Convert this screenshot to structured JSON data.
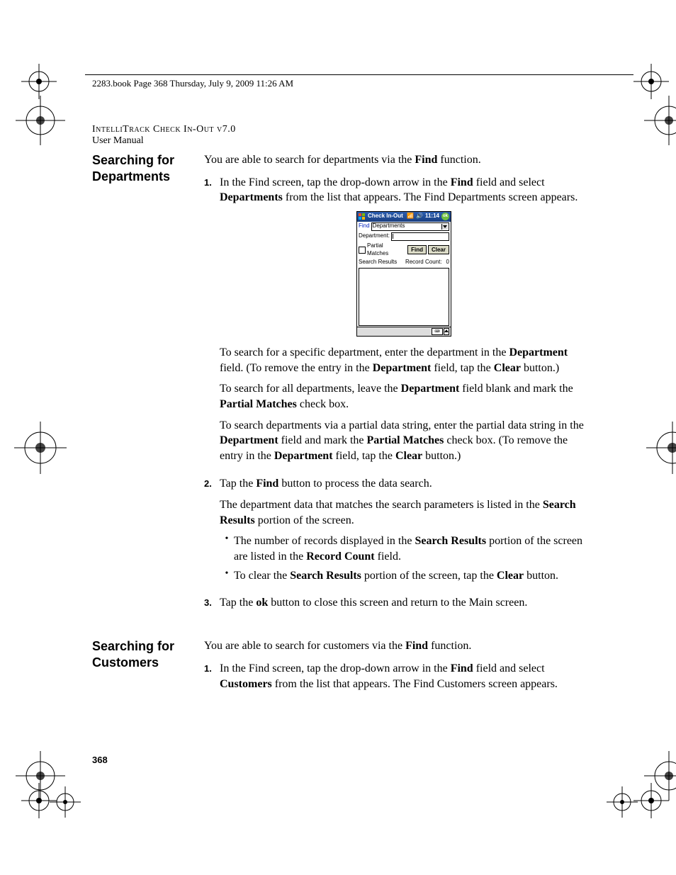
{
  "pageHeader": "2283.book  Page 368  Thursday, July 9, 2009  11:26 AM",
  "runningHead1": "IntelliTrack Check In-Out v7.0",
  "runningHead2": "User Manual",
  "pageNumber": "368",
  "sections": [
    {
      "heading": "Searching for Departments",
      "intro_pre": "You are able to search for departments via the ",
      "intro_bold": "Find",
      "intro_post": " function.",
      "steps": [
        {
          "num": "1.",
          "parts": [
            "In the Find screen, tap the drop-down arrow in the ",
            "Find",
            " field and select ",
            "Departments",
            " from the list that appears. The Find Departments screen appears."
          ],
          "bolds": [
            1,
            3
          ]
        }
      ],
      "afterImage": [
        {
          "parts": [
            "To search for a specific department, enter the department in the ",
            "Department",
            " field. (To remove the entry in the ",
            "Department",
            " field, tap the ",
            "Clear",
            " button.)"
          ],
          "bolds": [
            1,
            3,
            5
          ]
        },
        {
          "parts": [
            "To search for all departments, leave the ",
            "Department",
            " field blank and mark the ",
            "Partial Matches",
            " check box."
          ],
          "bolds": [
            1,
            3
          ]
        },
        {
          "parts": [
            "To search departments via a partial data string, enter the partial data string in the ",
            "Department",
            " field and mark the ",
            "Partial Matches",
            " check box. (To remove the entry in the ",
            "Department",
            " field, tap the ",
            "Clear",
            " button.)"
          ],
          "bolds": [
            1,
            3,
            5,
            7
          ]
        }
      ],
      "steps2": [
        {
          "num": "2.",
          "parts": [
            "Tap the ",
            "Find",
            " button to process the data search."
          ],
          "bolds": [
            1
          ],
          "followParas": [
            {
              "parts": [
                "The department data that matches the search parameters is listed in the ",
                "Search Results",
                " portion of the screen."
              ],
              "bolds": [
                1
              ]
            }
          ],
          "bullets": [
            {
              "parts": [
                "The number of records displayed in the ",
                "Search Results",
                " portion of the screen are listed in the ",
                "Record Count",
                " field."
              ],
              "bolds": [
                1,
                3
              ]
            },
            {
              "parts": [
                "To clear the ",
                "Search Results",
                " portion of the screen, tap the ",
                "Clear",
                " button."
              ],
              "bolds": [
                1,
                3
              ]
            }
          ]
        },
        {
          "num": "3.",
          "parts": [
            "Tap the ",
            "ok",
            " button to close this screen and return to the Main screen."
          ],
          "bolds": [
            1
          ]
        }
      ]
    },
    {
      "heading": "Searching for Customers",
      "intro_pre": "You are able to search for customers via the ",
      "intro_bold": "Find",
      "intro_post": " function.",
      "steps": [
        {
          "num": "1.",
          "parts": [
            "In the Find screen, tap the drop-down arrow in the ",
            "Find",
            " field and select ",
            "Customers",
            " from the list that appears. The Find Customers screen appears."
          ],
          "bolds": [
            1,
            3
          ]
        }
      ]
    }
  ],
  "device": {
    "title": "Check In-Out",
    "time": "11:14",
    "ok": "ok",
    "findLabel": "Find",
    "findValue": "Departments",
    "deptLabel": "Department:",
    "deptValue": "",
    "partial": "Partial Matches",
    "findBtn": "Find",
    "clearBtn": "Clear",
    "results": "Search Results",
    "recordCount": "Record Count:",
    "recordCountVal": "0"
  }
}
